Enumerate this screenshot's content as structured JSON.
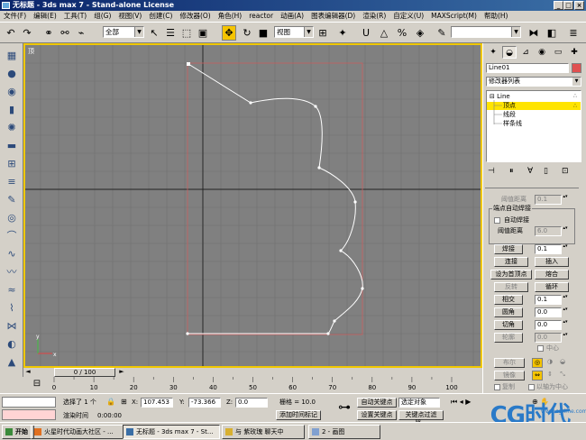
{
  "window": {
    "title": "无标题 - 3ds max 7 - Stand-alone License"
  },
  "menu": [
    "文件(F)",
    "编辑(E)",
    "工具(T)",
    "组(G)",
    "视图(V)",
    "创建(C)",
    "修改器(O)",
    "角色(H)",
    "reactor",
    "动画(A)",
    "图表编辑器(D)",
    "渲染(R)",
    "自定义(U)",
    "MAXScript(M)",
    "帮助(H)"
  ],
  "toolbar": {
    "selection_filter": "全部",
    "ref_coord": "视图"
  },
  "viewport": {
    "label": "顶"
  },
  "timeline": {
    "slider_label": "0 / 100",
    "ticks": [
      "0",
      "10",
      "20",
      "30",
      "40",
      "50",
      "60",
      "70",
      "80",
      "90",
      "100"
    ]
  },
  "panel": {
    "object_name": "Line01",
    "modifier_list": "修改器列表",
    "stack": {
      "root": "Line",
      "items": [
        "顶点",
        "线段",
        "样条线"
      ],
      "selected": "顶点"
    },
    "threshold1_label": "阈值距离",
    "threshold1_value": "0.1",
    "auto_weld_group": "端点自动焊接",
    "auto_weld_check": "自动焊接",
    "threshold2_label": "阈值距离",
    "threshold2_value": "6.0",
    "weld_button": "焊接",
    "weld_value": "0.1",
    "connect_button": "连接",
    "insert_button": "插入",
    "make_first_button": "设为首顶点",
    "fuse_button": "熔合",
    "reverse_button": "反转",
    "cycle_button": "循环",
    "intersect_button": "相交",
    "intersect_value": "0.1",
    "fillet_button": "圆角",
    "fillet_value": "0.0",
    "chamfer_button": "切角",
    "chamfer_value": "0.0",
    "outline_button": "轮廓",
    "outline_value": "0.0",
    "center_check": "中心",
    "boolean_button": "布尔",
    "mirror_button": "镜像",
    "copy_check": "复制",
    "about_pivot_check": "以轴为中心"
  },
  "status": {
    "selected": "选择了 1 个",
    "x_label": "X:",
    "x_value": "107.453",
    "y_label": "Y:",
    "y_value": "-73.366",
    "z_label": "Z:",
    "z_value": "0.0",
    "grid": "栅格 = 10.0",
    "autokey": "自动关键点",
    "selected_obj": "选定对象",
    "render_time_label": "渲染时间",
    "render_time": "0:00:00",
    "add_time_tag": "添加时间标记",
    "set_key": "设置关键点",
    "key_filter": "关键点过滤器..."
  },
  "taskbar": {
    "start": "开始",
    "tasks": [
      "火星时代动画大社区 - ...",
      "无标题 - 3ds max 7 - St...",
      "与 紫玫瑰 聊天中",
      "2 - 画图"
    ]
  },
  "watermark": "CG时代",
  "watermark_url": "www.cgtime.com"
}
